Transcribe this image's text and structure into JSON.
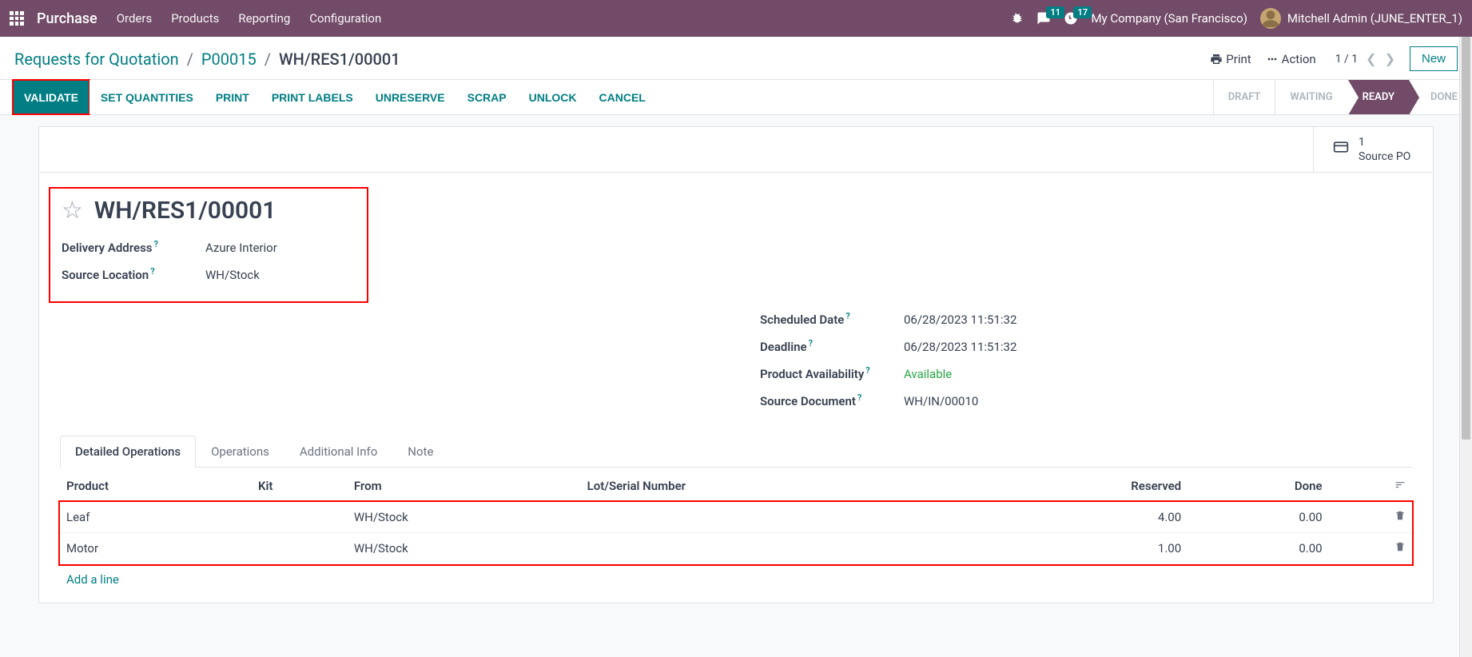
{
  "navbar": {
    "brand": "Purchase",
    "menu": [
      "Orders",
      "Products",
      "Reporting",
      "Configuration"
    ],
    "msg_badge": "11",
    "activity_badge": "17",
    "company": "My Company (San Francisco)",
    "user": "Mitchell Admin (JUNE_ENTER_1)"
  },
  "breadcrumb": {
    "root": "Requests for Quotation",
    "mid": "P00015",
    "current": "WH/RES1/00001"
  },
  "toolbar": {
    "print": "Print",
    "action": "Action",
    "pager": "1 / 1",
    "new": "New"
  },
  "actions": {
    "validate": "Validate",
    "set_quantities": "Set Quantities",
    "print": "Print",
    "print_labels": "Print Labels",
    "unreserve": "Unreserve",
    "scrap": "Scrap",
    "unlock": "Unlock",
    "cancel": "Cancel"
  },
  "status": {
    "draft": "Draft",
    "waiting": "Waiting",
    "ready": "Ready",
    "done": "Done"
  },
  "smart": {
    "source_po_count": "1",
    "source_po_label": "Source PO"
  },
  "record": {
    "name": "WH/RES1/00001",
    "delivery_address_label": "Delivery Address",
    "delivery_address": "Azure Interior",
    "source_location_label": "Source Location",
    "source_location": "WH/Stock",
    "scheduled_date_label": "Scheduled Date",
    "scheduled_date": "06/28/2023 11:51:32",
    "deadline_label": "Deadline",
    "deadline": "06/28/2023 11:51:32",
    "availability_label": "Product Availability",
    "availability": "Available",
    "source_doc_label": "Source Document",
    "source_doc": "WH/IN/00010"
  },
  "tabs": {
    "detailed": "Detailed Operations",
    "operations": "Operations",
    "additional": "Additional Info",
    "note": "Note"
  },
  "table": {
    "headers": {
      "product": "Product",
      "kit": "Kit",
      "from": "From",
      "lot": "Lot/Serial Number",
      "reserved": "Reserved",
      "done": "Done"
    },
    "rows": [
      {
        "product": "Leaf",
        "kit": "",
        "from": "WH/Stock",
        "lot": "",
        "reserved": "4.00",
        "done": "0.00"
      },
      {
        "product": "Motor",
        "kit": "",
        "from": "WH/Stock",
        "lot": "",
        "reserved": "1.00",
        "done": "0.00"
      }
    ],
    "add_line": "Add a line"
  }
}
